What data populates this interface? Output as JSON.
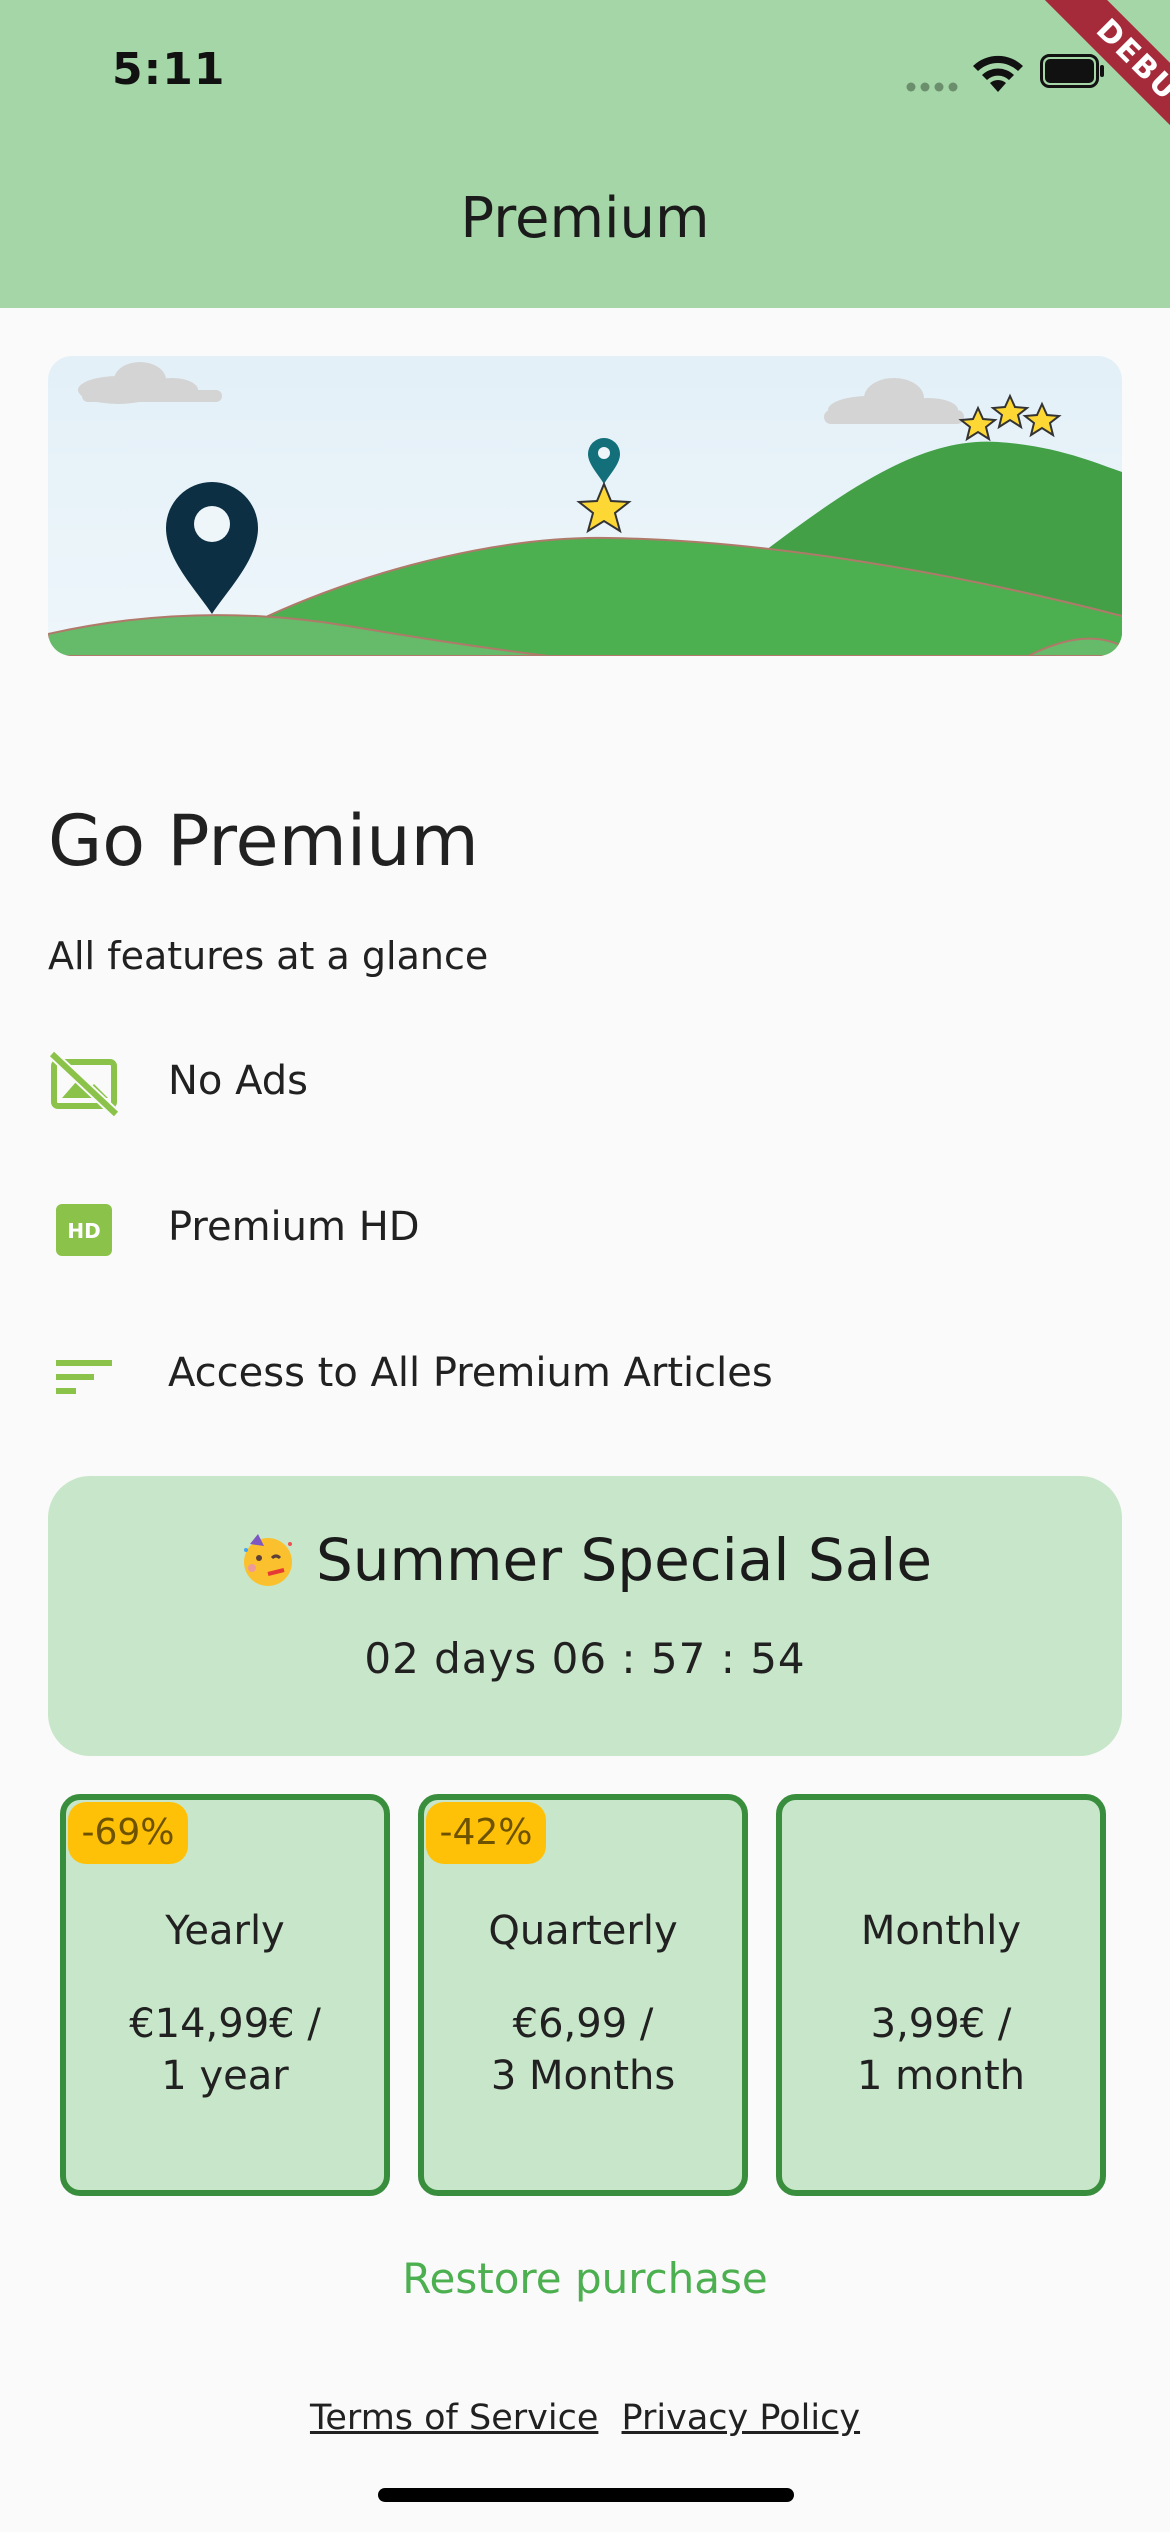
{
  "status_bar": {
    "time": "5:11"
  },
  "debug_banner": "DEBUG",
  "app_bar": {
    "title": "Premium"
  },
  "content": {
    "title": "Go Premium",
    "subtitle": "All features at a glance",
    "features": [
      {
        "label": "No Ads",
        "icon": "no-ads-icon"
      },
      {
        "label": "Premium HD",
        "icon": "hd-icon"
      },
      {
        "label": "Access to All Premium Articles",
        "icon": "article-lines-icon"
      }
    ]
  },
  "sale": {
    "emoji": "party-face-icon",
    "title": "Summer Special Sale",
    "countdown": "02 days 06 : 57 : 54"
  },
  "plans": [
    {
      "badge": "-69%",
      "name": "Yearly",
      "price_line1": "€14,99€ /",
      "price_line2": "1 year"
    },
    {
      "badge": "-42%",
      "name": "Quarterly",
      "price_line1": "€6,99 /",
      "price_line2": "3 Months"
    },
    {
      "badge": "",
      "name": "Monthly",
      "price_line1": "3,99€ /",
      "price_line2": "1 month"
    }
  ],
  "restore_label": "Restore purchase",
  "footer": {
    "terms": "Terms of Service",
    "privacy": "Privacy Policy"
  },
  "colors": {
    "app_bar": "#a5d6a7",
    "accent": "#4caf50",
    "card_bg": "#c8e6c9",
    "card_border": "#388e3c",
    "badge": "#ffc107",
    "debug": "#a52a3a"
  }
}
